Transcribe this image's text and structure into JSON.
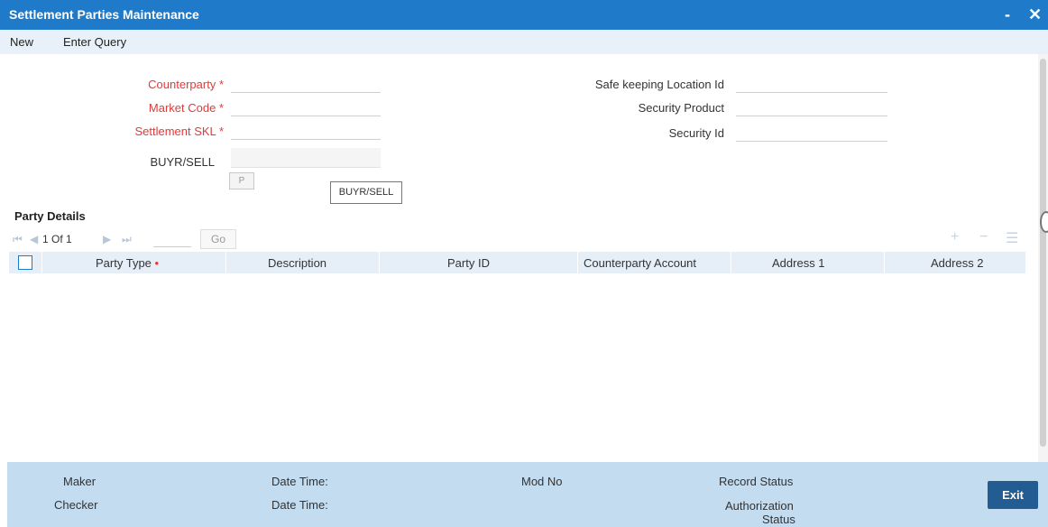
{
  "window": {
    "title": "Settlement Parties Maintenance",
    "minimize": "-",
    "close": "✕"
  },
  "menu": {
    "new": "New",
    "enter_query": "Enter Query"
  },
  "form": {
    "counterparty": "Counterparty",
    "market_code": "Market Code",
    "settlement_skl": "Settlement SKL",
    "buyr_sell": "BUYR/SELL",
    "required_mark": "*",
    "safe_keeping_location_id": "Safe keeping Location Id",
    "security_product": "Security Product",
    "security_id": "Security Id",
    "p_button": "P",
    "tooltip": "BUYR/SELL"
  },
  "party_details": {
    "title": "Party Details",
    "pager": {
      "first": "⏮",
      "prev": "◀",
      "page_text": "1 Of 1",
      "next": "▶",
      "last": "⏭",
      "go": "Go"
    },
    "tools": {
      "add": "+",
      "remove": "−",
      "view": "☰"
    },
    "columns": [
      "Party Type",
      "Description",
      "Party ID",
      "Counterparty Account",
      "Address 1",
      "Address 2"
    ],
    "required_mark": "•"
  },
  "footer": {
    "maker": "Maker",
    "checker": "Checker",
    "date_time_1": "Date Time:",
    "date_time_2": "Date Time:",
    "mod_no": "Mod No",
    "record_status": "Record Status",
    "authorization_status_1": "Authorization",
    "authorization_status_2": "Status",
    "exit": "Exit"
  }
}
